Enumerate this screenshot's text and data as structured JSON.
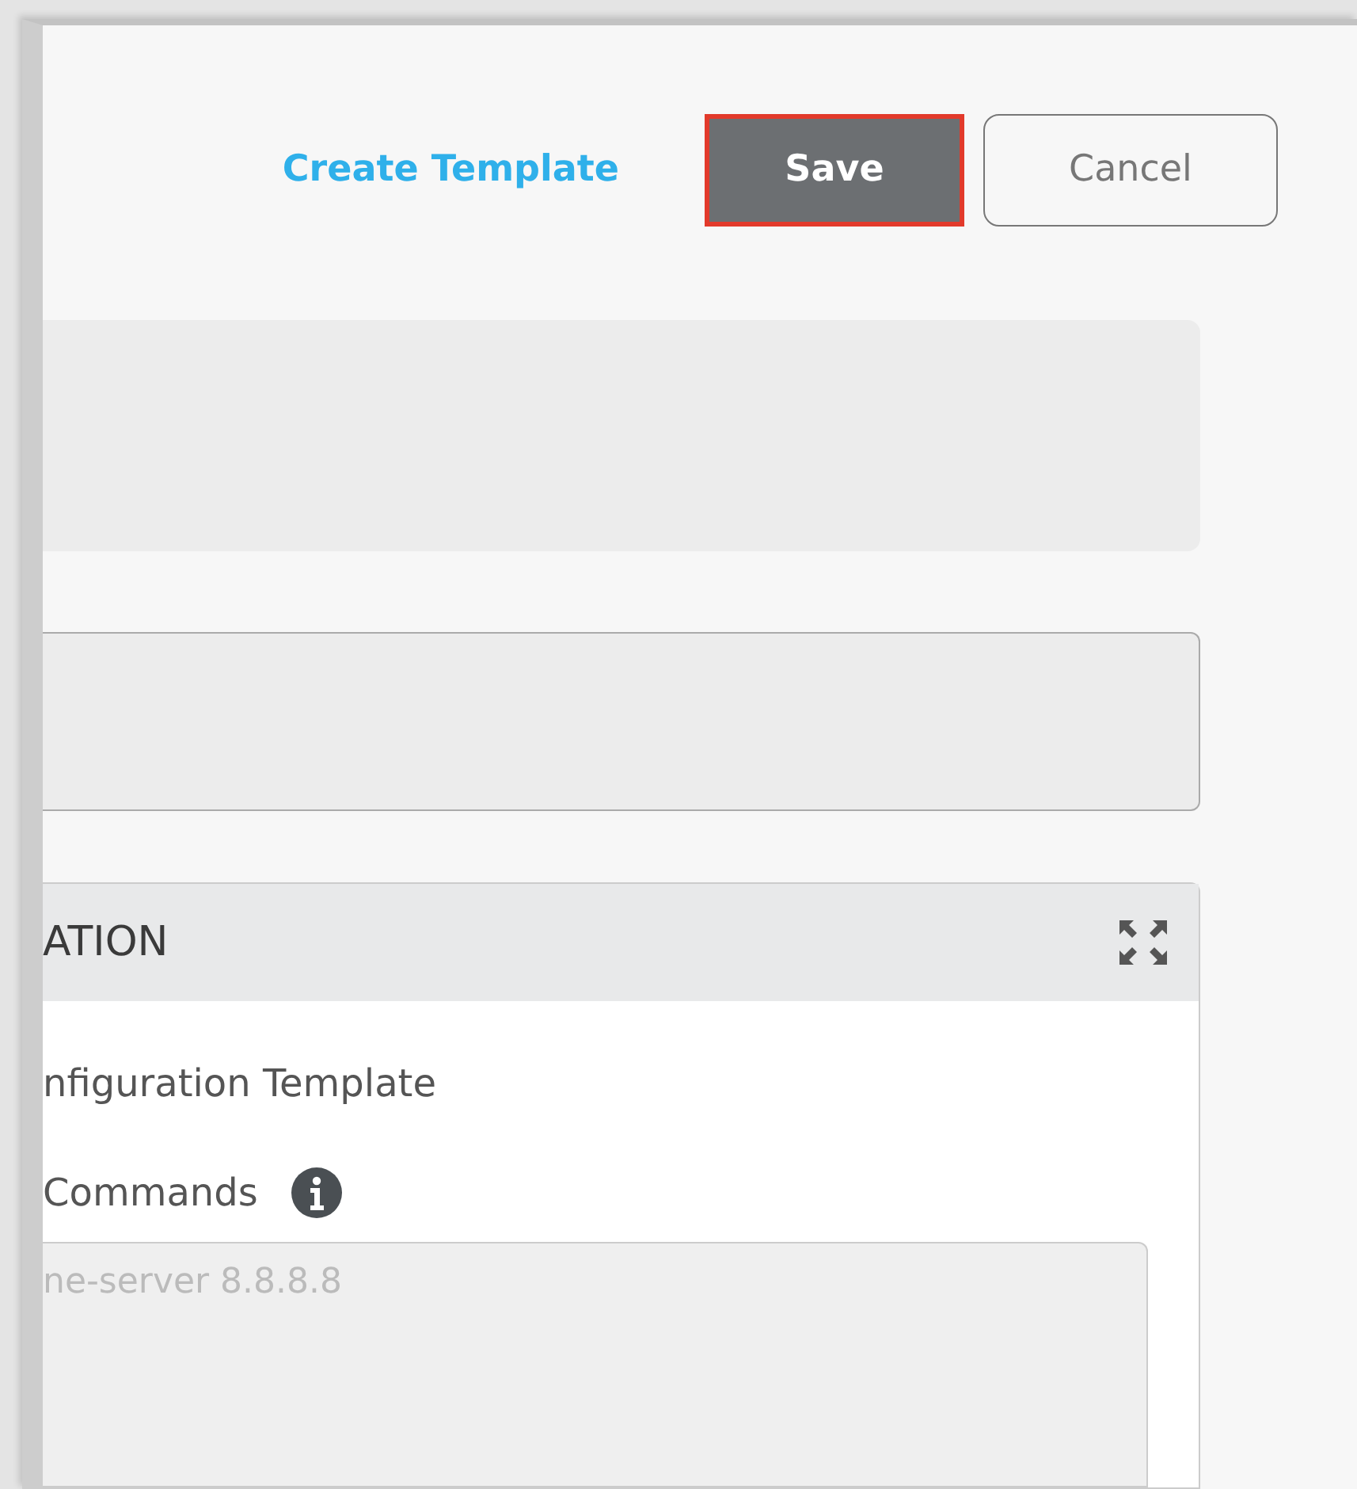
{
  "header": {
    "link": "Create Template",
    "buttons": [
      {
        "label": "Save",
        "kind": "primary",
        "highlighted": true
      },
      {
        "label": "Cancel",
        "kind": "secondary",
        "highlighted": false
      }
    ]
  },
  "section": {
    "title": "ATION",
    "template_label": "nfiguration Template",
    "commands_label": "Commands",
    "commands_field": {
      "placeholder": "ne-server 8.8.8.8"
    }
  }
}
